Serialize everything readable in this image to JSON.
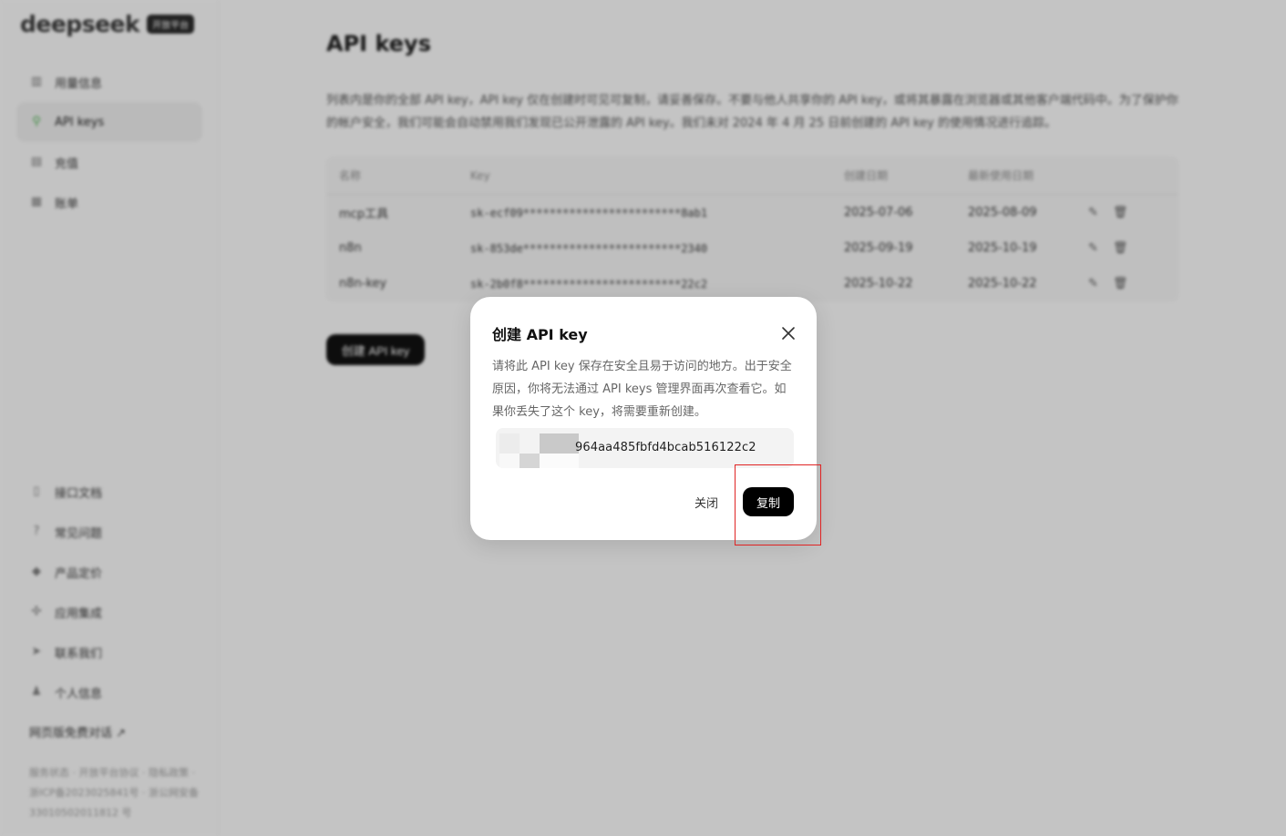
{
  "brand": {
    "logo_text": "deepseek",
    "badge": "开放平台"
  },
  "sidebar": {
    "top_items": [
      {
        "label": "用量信息",
        "icon": "bar-chart-icon"
      },
      {
        "label": "API keys",
        "icon": "key-search-icon",
        "active": true
      },
      {
        "label": "充值",
        "icon": "wallet-icon"
      },
      {
        "label": "账单",
        "icon": "receipt-icon"
      }
    ],
    "bottom_items": [
      {
        "label": "接口文档",
        "icon": "doc-icon"
      },
      {
        "label": "常见问题",
        "icon": "question-icon"
      },
      {
        "label": "产品定价",
        "icon": "tag-icon"
      },
      {
        "label": "应用集成",
        "icon": "puzzle-icon"
      },
      {
        "label": "联系我们",
        "icon": "send-icon"
      },
      {
        "label": "个人信息",
        "icon": "user-icon"
      }
    ],
    "free_chat": "网页版免费对话 ↗",
    "footer": "服务状态 · 开放平台协议 · 隐私政策 · 浙ICP备2023025841号 · 浙公网安备 33010502011812 号"
  },
  "main": {
    "title": "API keys",
    "description": "列表内是你的全部 API key，API key 仅在创建时可见可复制，请妥善保存。不要与他人共享你的 API key，或将其暴露在浏览器或其他客户端代码中。为了保护你的帐户安全，我们可能会自动禁用我们发现已公开泄露的 API key。我们未对 2024 年 4 月 25 日前创建的 API key 的使用情况进行追踪。",
    "table": {
      "headers": [
        "名称",
        "Key",
        "创建日期",
        "最新使用日期"
      ],
      "rows": [
        [
          "mcp工具",
          "sk-ecf09************************8ab1",
          "2025-07-06",
          "2025-08-09"
        ],
        [
          "n8n",
          "sk-853de************************2340",
          "2025-09-19",
          "2025-10-19"
        ],
        [
          "n8n-key",
          "sk-2b0f8************************22c2",
          "2025-10-22",
          "2025-10-22"
        ]
      ]
    },
    "create_button": "创建 API key"
  },
  "modal": {
    "title": "创建 API key",
    "description": "请将此 API key 保存在安全且易于访问的地方。出于安全原因，你将无法通过 API keys 管理界面再次查看它。如果你丢失了这个 key，将需要重新创建。",
    "key_visible_suffix": "964aa485fbfd4bcab516122c2",
    "close_label": "关闭",
    "copy_label": "复制"
  },
  "colors": {
    "highlight": "#e02424",
    "primary_button": "#000000",
    "overlay": "rgba(0,0,0,0.2)"
  }
}
